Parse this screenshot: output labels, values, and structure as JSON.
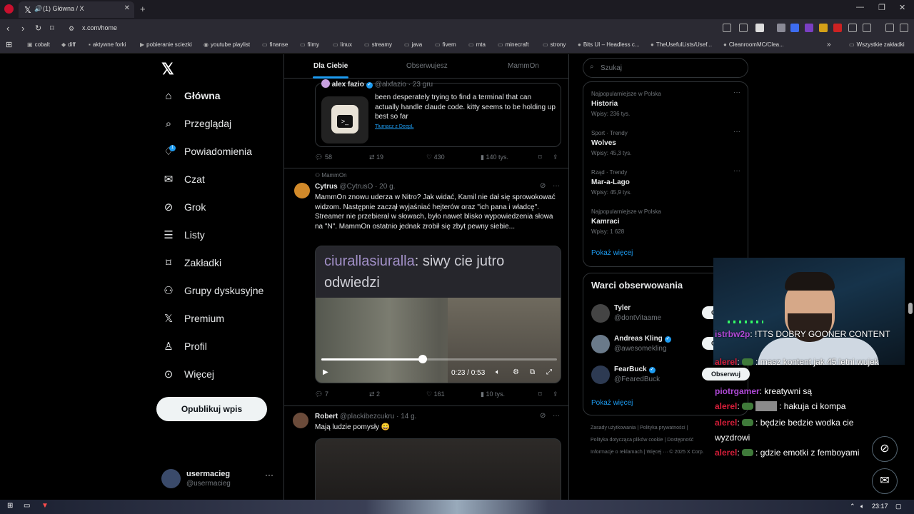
{
  "browser": {
    "tab_title": "(1) Główna / X",
    "url": "x.com/home",
    "bookmarks": [
      "cobalt",
      "diff",
      "aktywne forki",
      "pobieranie sciezki",
      "youtube playlist",
      "finanse",
      "filmy",
      "linux",
      "streamy",
      "java",
      "fivem",
      "mta",
      "minecraft",
      "strony",
      "Bits UI – Headless c...",
      "TheUsefulLists/Usef...",
      "CleanroomMC/Clea...",
      "Wszystkie zakładki"
    ]
  },
  "nav": {
    "items": [
      "Główna",
      "Przeglądaj",
      "Powiadomienia",
      "Czat",
      "Grok",
      "Listy",
      "Zakładki",
      "Grupy dyskusyjne",
      "Premium",
      "Profil",
      "Więcej"
    ],
    "notif_badge": "1",
    "post_button": "Opublikuj wpis",
    "account_name": "usermacieg",
    "account_handle": "@usermacieg"
  },
  "feed": {
    "tabs": [
      "Dla Ciebie",
      "Obserwujesz",
      "MammOn"
    ],
    "tweet1": {
      "name": "alex fazio",
      "handle": "@alxfazio · 23 gru",
      "text": "been desperately trying to find a terminal that can actually handle claude code. kitty seems to be holding up best so far",
      "translate": "Tłumacz z DeepL",
      "replies": "58",
      "retweets": "19",
      "likes": "430",
      "views": "140 tys."
    },
    "tweet2": {
      "context": "MammOn",
      "name": "Cytrus",
      "handle": "@CytrusO · 20 g.",
      "text": "MammOn znowu uderza w Nitro? Jak widać, Kamil nie dał się sprowokować widzom. Następnie zaczął wyjaśniać hejterów oraz \"ich pana i władcę\". Streamer nie przebierał w słowach, było nawet blisko wypowiedzenia słowa na \"N\". MammOn ostatnio jednak zrobił się zbyt pewny siebie...",
      "video_chat_user": "ciurallasiuralla",
      "video_chat_text": ": siwy cie jutro odwiedzi",
      "video_time": "0:23 / 0:53",
      "video_progress": 0.43,
      "replies": "7",
      "retweets": "2",
      "likes": "161",
      "views": "10 tys."
    },
    "tweet3": {
      "name": "Robert",
      "handle": "@plackibezcukru · 14 g.",
      "text": "Mają ludzie pomysły 😄"
    }
  },
  "sidebar": {
    "search_placeholder": "Szukaj",
    "trends": [
      {
        "meta": "Najpopularniejsze w Polska",
        "title": "Historia",
        "count": "Wpisy: 236 tys."
      },
      {
        "meta": "Sport · Trendy",
        "title": "Wolves",
        "count": "Wpisy: 45,3 tys."
      },
      {
        "meta": "Rząd · Trendy",
        "title": "Mar-a-Lago",
        "count": "Wpisy: 45,9 tys."
      },
      {
        "meta": "Najpopularniejsze w Polska",
        "title": "Kamraci",
        "count": "Wpisy: 1 628"
      }
    ],
    "show_more": "Pokaż więcej",
    "wtf_title": "Warci obserwowania",
    "wtf": [
      {
        "name": "Tyler",
        "handle": "@dontVitaame",
        "button": "Obserwuj"
      },
      {
        "name": "Andreas Kling",
        "handle": "@awesomekling",
        "button": "Obserwuj"
      },
      {
        "name": "FearBuck",
        "handle": "@FearedBuck",
        "button": "Obserwuj"
      }
    ],
    "footer": [
      "Zasady użytkowania",
      "Polityka prywatności",
      "Polityka dotycząca plików cookie",
      "Dostępność",
      "Informacje o reklamach",
      "Więcej ···",
      "© 2025 X Corp."
    ]
  },
  "stream_chat": [
    {
      "user": "istrbw2p",
      "text": ": !TTS DOBRY GOONER CONTENT"
    },
    {
      "user": "alerel",
      "text": ": masz kontent jak 45 letni wujek"
    },
    {
      "user": "piotrgamer",
      "text": ": kreatywni są"
    },
    {
      "user": "alerel",
      "text": ": hakuja ci kompa"
    },
    {
      "user": "alerel",
      "text": ": będzie bedzie wodka cie"
    },
    {
      "user": "",
      "text": "wyzdrowi"
    },
    {
      "user": "alerel",
      "text": ": gdzie emotki z femboyami"
    }
  ],
  "taskbar": {
    "clock": "23:17"
  }
}
